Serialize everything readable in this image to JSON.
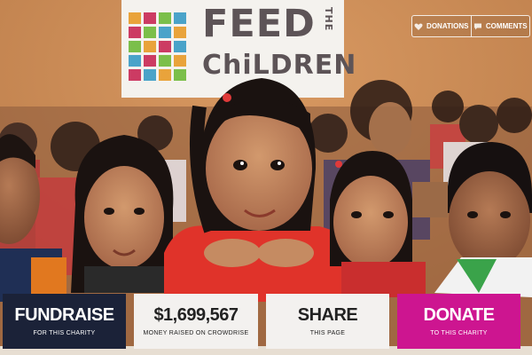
{
  "banner": {
    "line1": "FEED",
    "vertical": "THE",
    "line2": "ChiLDREN"
  },
  "top_links": {
    "donations_label": "DONATIONS",
    "comments_label": "COMMENTS"
  },
  "cta": {
    "fundraise": {
      "title": "FUNDRAISE",
      "subtitle": "FOR THIS CHARITY"
    },
    "raised": {
      "title": "$1,699,567",
      "subtitle": "MONEY RAISED ON CROWDRISE"
    },
    "share": {
      "title": "SHARE",
      "subtitle": "THIS PAGE"
    },
    "donate": {
      "title": "DONATE",
      "subtitle": "TO THIS CHARITY"
    }
  },
  "colors": {
    "fundraise_bg": "#1b2238",
    "donate_bg": "#cd1590",
    "light_bg": "#f3f1ef",
    "wall": "#c98a55"
  }
}
